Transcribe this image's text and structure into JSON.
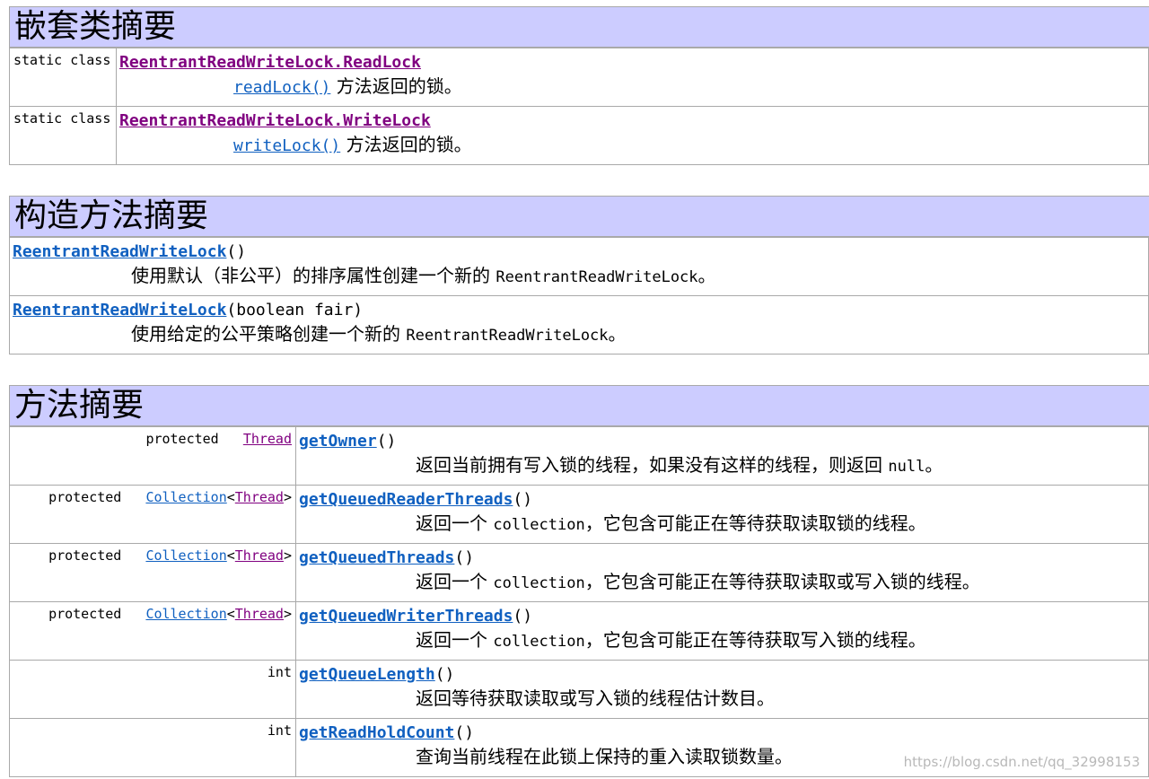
{
  "nested": {
    "title": "嵌套类摘要",
    "rows": [
      {
        "modifier": "static class",
        "name": "ReentrantReadWriteLock.ReadLock",
        "method": "readLock()",
        "desc": "方法返回的锁。"
      },
      {
        "modifier": "static class",
        "name": "ReentrantReadWriteLock.WriteLock",
        "method": "writeLock()",
        "desc": "方法返回的锁。"
      }
    ]
  },
  "ctors": {
    "title": "构造方法摘要",
    "rows": [
      {
        "name": "ReentrantReadWriteLock",
        "params": "()",
        "desc": "使用默认（非公平）的排序属性创建一个新的",
        "code": "ReentrantReadWriteLock",
        "end": "。"
      },
      {
        "name": "ReentrantReadWriteLock",
        "params": "(boolean fair)",
        "desc": "使用给定的公平策略创建一个新的",
        "code": "ReentrantReadWriteLock",
        "end": "。"
      }
    ]
  },
  "methods": {
    "title": "方法摘要",
    "rows": [
      {
        "modifier": "protected",
        "type": "Thread",
        "type_arg": "",
        "name": "getOwner",
        "params": "()",
        "desc": "返回当前拥有写入锁的线程，如果没有这样的线程，则返回",
        "code": "null",
        "end": "。"
      },
      {
        "modifier": "protected",
        "type": "Collection",
        "type_arg": "Thread",
        "name": "getQueuedReaderThreads",
        "params": "()",
        "desc": "返回一个",
        "code": "collection",
        "end": "，它包含可能正在等待获取读取锁的线程。"
      },
      {
        "modifier": "protected",
        "type": "Collection",
        "type_arg": "Thread",
        "name": "getQueuedThreads",
        "params": "()",
        "desc": "返回一个",
        "code": "collection",
        "end": "，它包含可能正在等待获取读取或写入锁的线程。"
      },
      {
        "modifier": "protected",
        "type": "Collection",
        "type_arg": "Thread",
        "name": "getQueuedWriterThreads",
        "params": "()",
        "desc": "返回一个",
        "code": "collection",
        "end": "，它包含可能正在等待获取写入锁的线程。"
      },
      {
        "modifier": "int",
        "type": "",
        "type_arg": "",
        "name": "getQueueLength",
        "params": "()",
        "desc": "返回等待获取读取或写入锁的线程估计数目。",
        "code": "",
        "end": ""
      },
      {
        "modifier": "int",
        "type": "",
        "type_arg": "",
        "name": "getReadHoldCount",
        "params": "()",
        "desc": "查询当前线程在此锁上保持的重入读取锁数量。",
        "code": "",
        "end": ""
      }
    ]
  },
  "watermark": "https://blog.csdn.net/qq_32998153"
}
